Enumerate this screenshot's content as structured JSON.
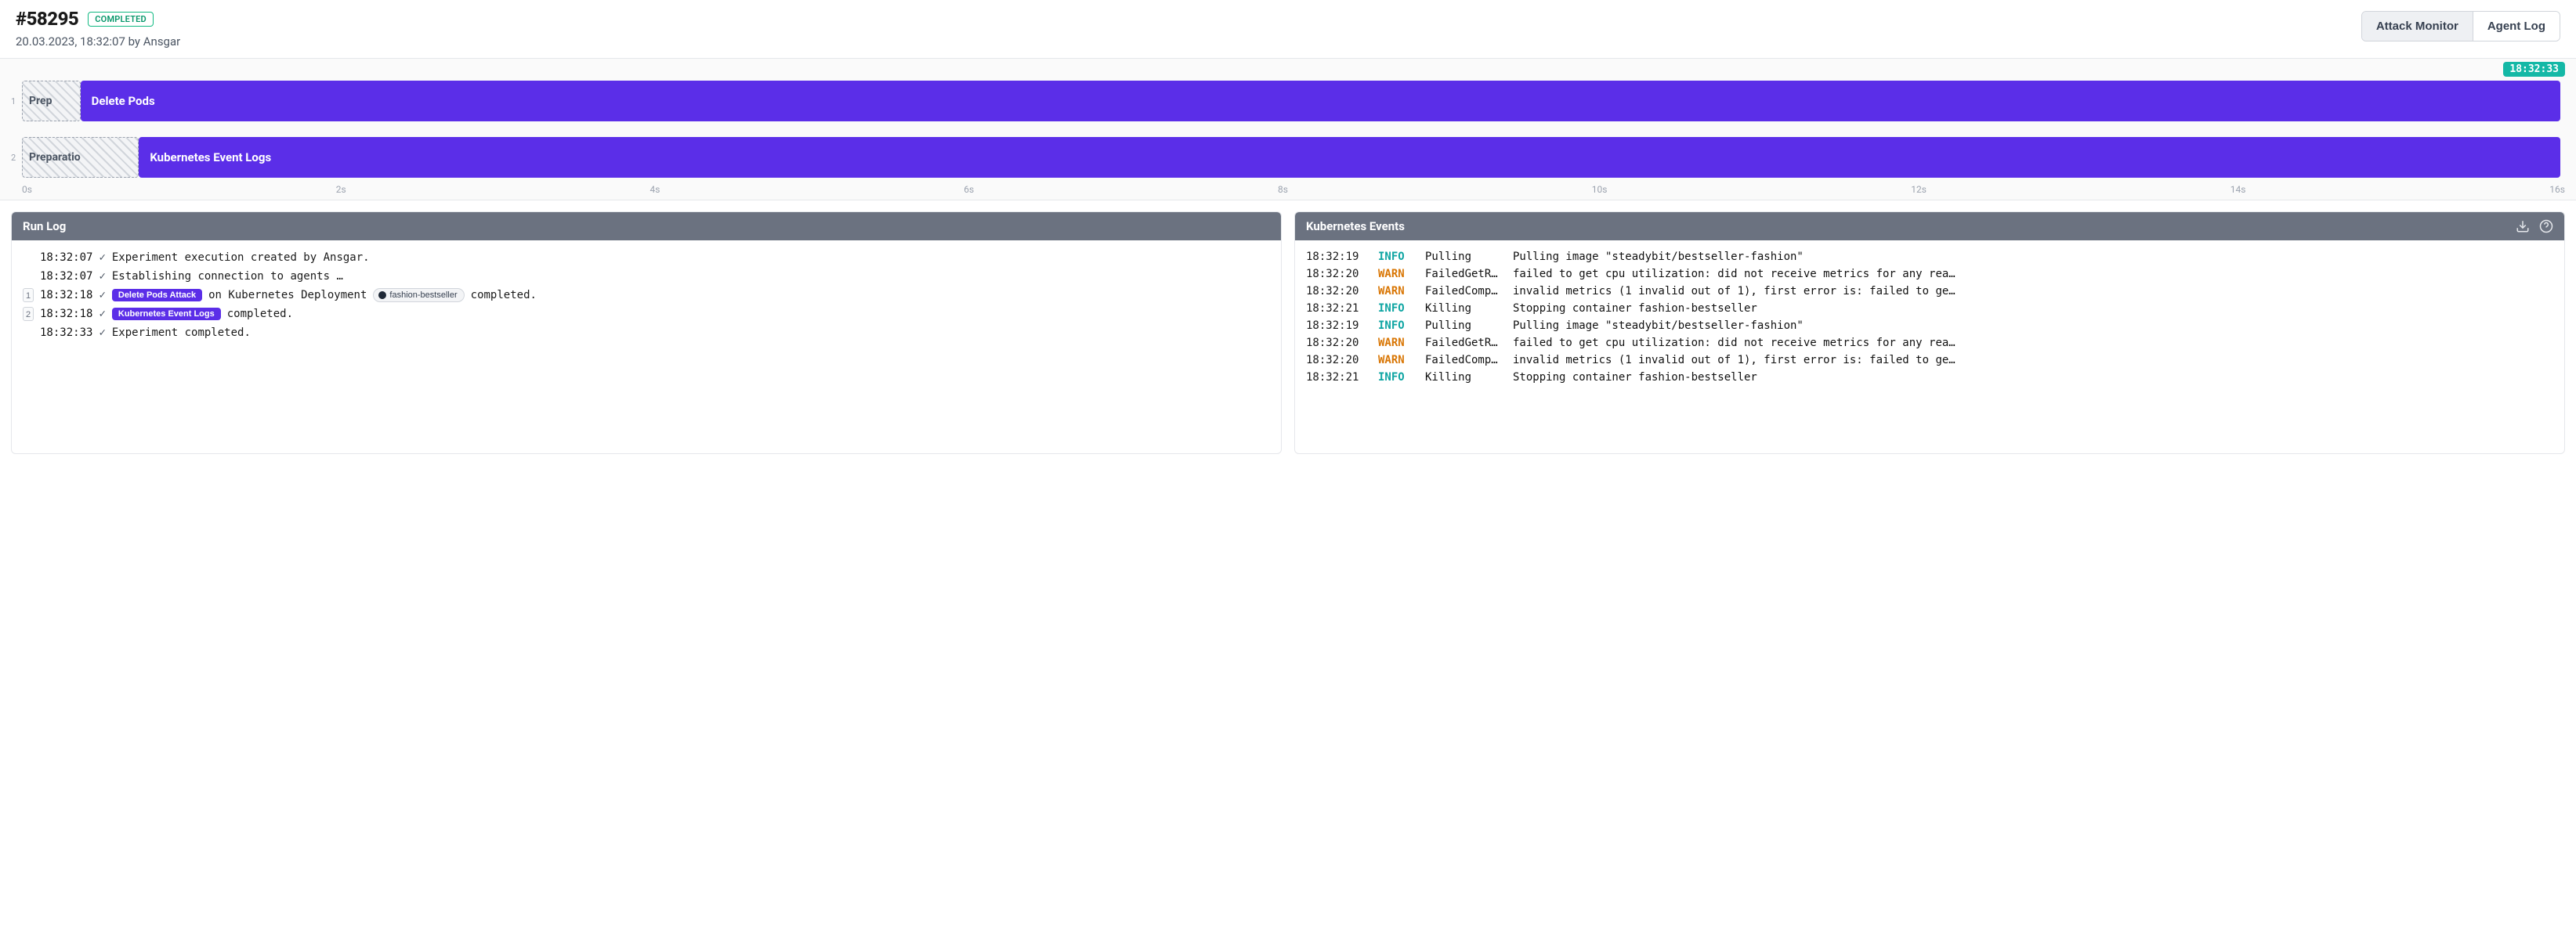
{
  "header": {
    "run_id": "#58295",
    "status": "COMPLETED",
    "meta": "20.03.2023, 18:32:07 by Ansgar",
    "tabs": {
      "attack_monitor": "Attack Monitor",
      "agent_log": "Agent Log"
    }
  },
  "timeline": {
    "current_time": "18:32:33",
    "axis": [
      "0s",
      "2s",
      "4s",
      "6s",
      "8s",
      "10s",
      "12s",
      "14s",
      "16s"
    ],
    "lanes": [
      {
        "num": "1",
        "prep_label": "Prep",
        "prep_width_pct": 2.3,
        "main_left_pct": 2.3,
        "main_width_pct": 97.5,
        "label": "Delete Pods"
      },
      {
        "num": "2",
        "prep_label": "Preparatio",
        "prep_width_pct": 4.6,
        "main_left_pct": 4.6,
        "main_width_pct": 95.2,
        "label": "Kubernetes Event Logs"
      }
    ]
  },
  "run_log": {
    "title": "Run Log",
    "rows": [
      {
        "idx": "",
        "ts": "18:32:07",
        "check": true,
        "segments": [
          {
            "t": "text",
            "v": "Experiment execution created by Ansgar."
          }
        ]
      },
      {
        "idx": "",
        "ts": "18:32:07",
        "check": true,
        "segments": [
          {
            "t": "text",
            "v": "Establishing connection to agents …"
          }
        ]
      },
      {
        "idx": "1",
        "ts": "18:32:18",
        "check": true,
        "segments": [
          {
            "t": "pill",
            "v": "Delete Pods Attack"
          },
          {
            "t": "text",
            "v": " on Kubernetes Deployment "
          },
          {
            "t": "chip",
            "v": "fashion-bestseller"
          },
          {
            "t": "text",
            "v": " completed."
          }
        ]
      },
      {
        "idx": "2",
        "ts": "18:32:18",
        "check": true,
        "segments": [
          {
            "t": "pill",
            "v": "Kubernetes Event Logs"
          },
          {
            "t": "text",
            "v": " completed."
          }
        ]
      },
      {
        "idx": "",
        "ts": "18:32:33",
        "check": true,
        "segments": [
          {
            "t": "text",
            "v": "Experiment completed."
          }
        ]
      }
    ]
  },
  "k8s_events": {
    "title": "Kubernetes Events",
    "rows": [
      {
        "ts": "18:32:19",
        "lvl": "INFO",
        "reason": "Pulling",
        "msg": "Pulling image \"steadybit/bestseller-fashion\""
      },
      {
        "ts": "18:32:20",
        "lvl": "WARN",
        "reason": "FailedGetRe…",
        "msg": "failed to get cpu utilization: did not receive metrics for any rea…"
      },
      {
        "ts": "18:32:20",
        "lvl": "WARN",
        "reason": "FailedCompu…",
        "msg": "invalid metrics (1 invalid out of 1), first error is: failed to ge…"
      },
      {
        "ts": "18:32:21",
        "lvl": "INFO",
        "reason": "Killing",
        "msg": "Stopping container fashion-bestseller"
      },
      {
        "ts": "18:32:19",
        "lvl": "INFO",
        "reason": "Pulling",
        "msg": "Pulling image \"steadybit/bestseller-fashion\""
      },
      {
        "ts": "18:32:20",
        "lvl": "WARN",
        "reason": "FailedGetRe…",
        "msg": "failed to get cpu utilization: did not receive metrics for any rea…"
      },
      {
        "ts": "18:32:20",
        "lvl": "WARN",
        "reason": "FailedCompu…",
        "msg": "invalid metrics (1 invalid out of 1), first error is: failed to ge…"
      },
      {
        "ts": "18:32:21",
        "lvl": "INFO",
        "reason": "Killing",
        "msg": "Stopping container fashion-bestseller"
      }
    ]
  }
}
